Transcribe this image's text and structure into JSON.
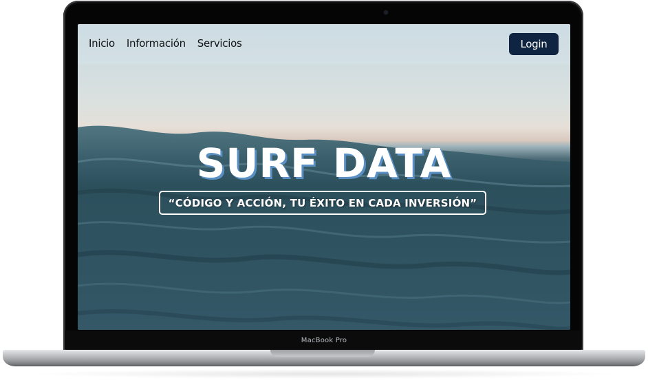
{
  "device": {
    "model_label": "MacBook Pro"
  },
  "nav": {
    "links": [
      {
        "label": "Inicio"
      },
      {
        "label": "Información"
      },
      {
        "label": "Servicios"
      }
    ],
    "login_label": "Login"
  },
  "hero": {
    "title": "SURF DATA",
    "tagline": "“CÓDIGO Y ACCIÓN, TU ÉXITO EN CADA INVERSIÓN”"
  },
  "colors": {
    "login_button": "#0f2440",
    "title_shadow": "#5a8fc4",
    "bezel": "#050505"
  }
}
